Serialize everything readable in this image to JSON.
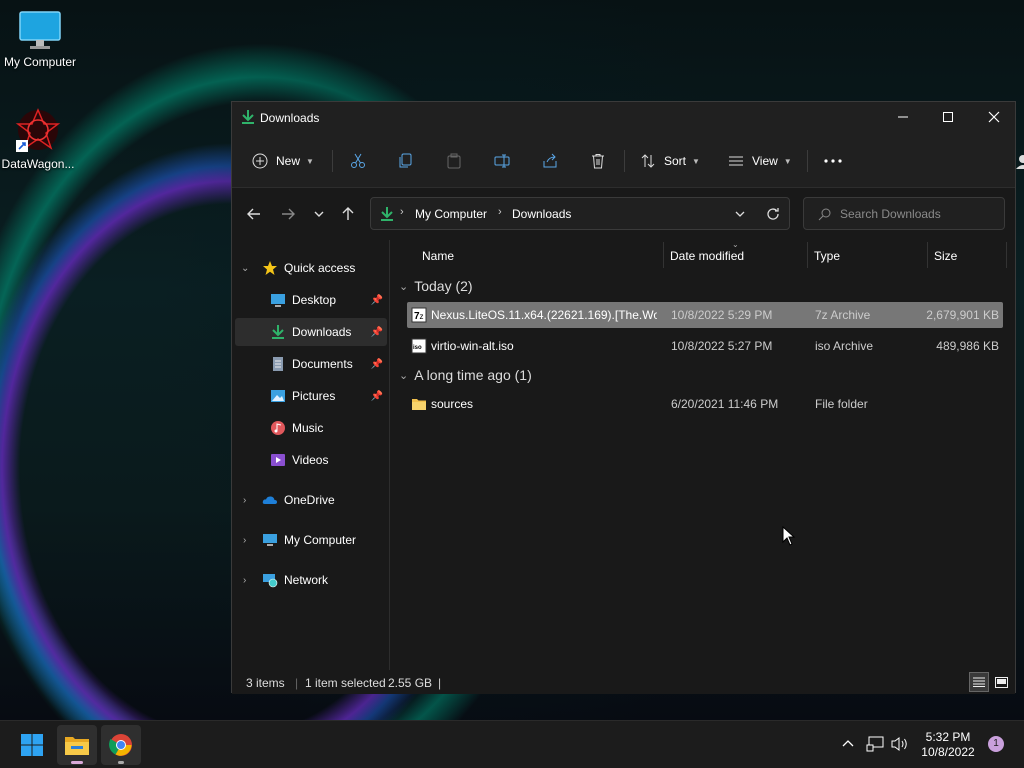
{
  "desktop": {
    "icons": [
      {
        "label": "My Computer"
      },
      {
        "label": "DataWagon..."
      }
    ]
  },
  "window": {
    "title": "Downloads",
    "toolbar": {
      "new_label": "New",
      "sort_label": "Sort",
      "view_label": "View"
    },
    "address": {
      "crumbs": [
        "My Computer",
        "Downloads"
      ]
    },
    "search": {
      "placeholder": "Search Downloads"
    },
    "nav": {
      "quick_access": "Quick access",
      "items": [
        {
          "label": "Desktop",
          "pinned": true
        },
        {
          "label": "Downloads",
          "pinned": true,
          "selected": true
        },
        {
          "label": "Documents",
          "pinned": true
        },
        {
          "label": "Pictures",
          "pinned": true
        },
        {
          "label": "Music",
          "pinned": false
        },
        {
          "label": "Videos",
          "pinned": false
        }
      ],
      "onedrive": "OneDrive",
      "my_computer": "My Computer",
      "network": "Network"
    },
    "columns": {
      "name": "Name",
      "date": "Date modified",
      "type": "Type",
      "size": "Size"
    },
    "groups": [
      {
        "label": "Today (2)",
        "files": [
          {
            "name": "Nexus.LiteOS.11.x64.(22621.169).[The.Wo...",
            "date": "10/8/2022 5:29 PM",
            "type": "7z Archive",
            "size": "2,679,901 KB",
            "selected": true,
            "icon": "7z-archive-icon"
          },
          {
            "name": "virtio-win-alt.iso",
            "date": "10/8/2022 5:27 PM",
            "type": "iso Archive",
            "size": "489,986 KB",
            "selected": false,
            "icon": "iso-archive-icon"
          }
        ]
      },
      {
        "label": "A long time ago (1)",
        "files": [
          {
            "name": "sources",
            "date": "6/20/2021 11:46 PM",
            "type": "File folder",
            "size": "",
            "selected": false,
            "icon": "folder-icon"
          }
        ]
      }
    ],
    "status": {
      "items": "3 items",
      "selected": "1 item selected",
      "size": "2.55 GB"
    }
  },
  "taskbar": {
    "time": "5:32 PM",
    "date": "10/8/2022",
    "notifications": "1"
  },
  "colors": {
    "accent_download": "#2fb36a",
    "folder": "#f2c14e",
    "selected_row": "#777777"
  }
}
